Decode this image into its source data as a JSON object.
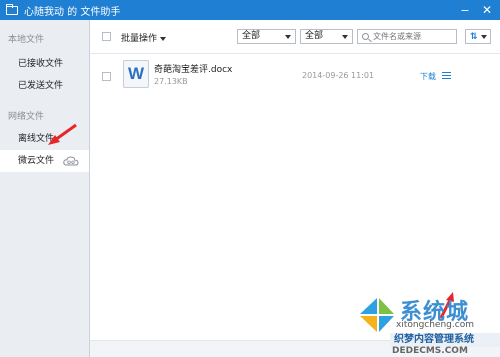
{
  "window": {
    "title": "心随我动 的 文件助手",
    "min_label": "−",
    "close_label": "✕"
  },
  "sidebar": {
    "section_local": "本地文件",
    "received": "已接收文件",
    "sent": "已发送文件",
    "section_network": "网络文件",
    "offline": "离线文件",
    "weiyun": "微云文件"
  },
  "toolbar": {
    "batch_label": "批量操作",
    "filter1": "全部",
    "filter2": "全部",
    "search_placeholder": "文件名或来源"
  },
  "files": [
    {
      "name": "奇葩淘宝差评.docx",
      "size": "27.13KB",
      "date": "2014-09-26 11:01",
      "action": "下载",
      "icon": "W"
    }
  ],
  "watermark": {
    "title": "系统城",
    "subtitle": "xitongcheng.com",
    "brand": "织梦内容管理系统",
    "site": "DEDECMS.COM"
  },
  "colors": {
    "accent": "#1f7fd3",
    "arrow": "#e8262a"
  }
}
